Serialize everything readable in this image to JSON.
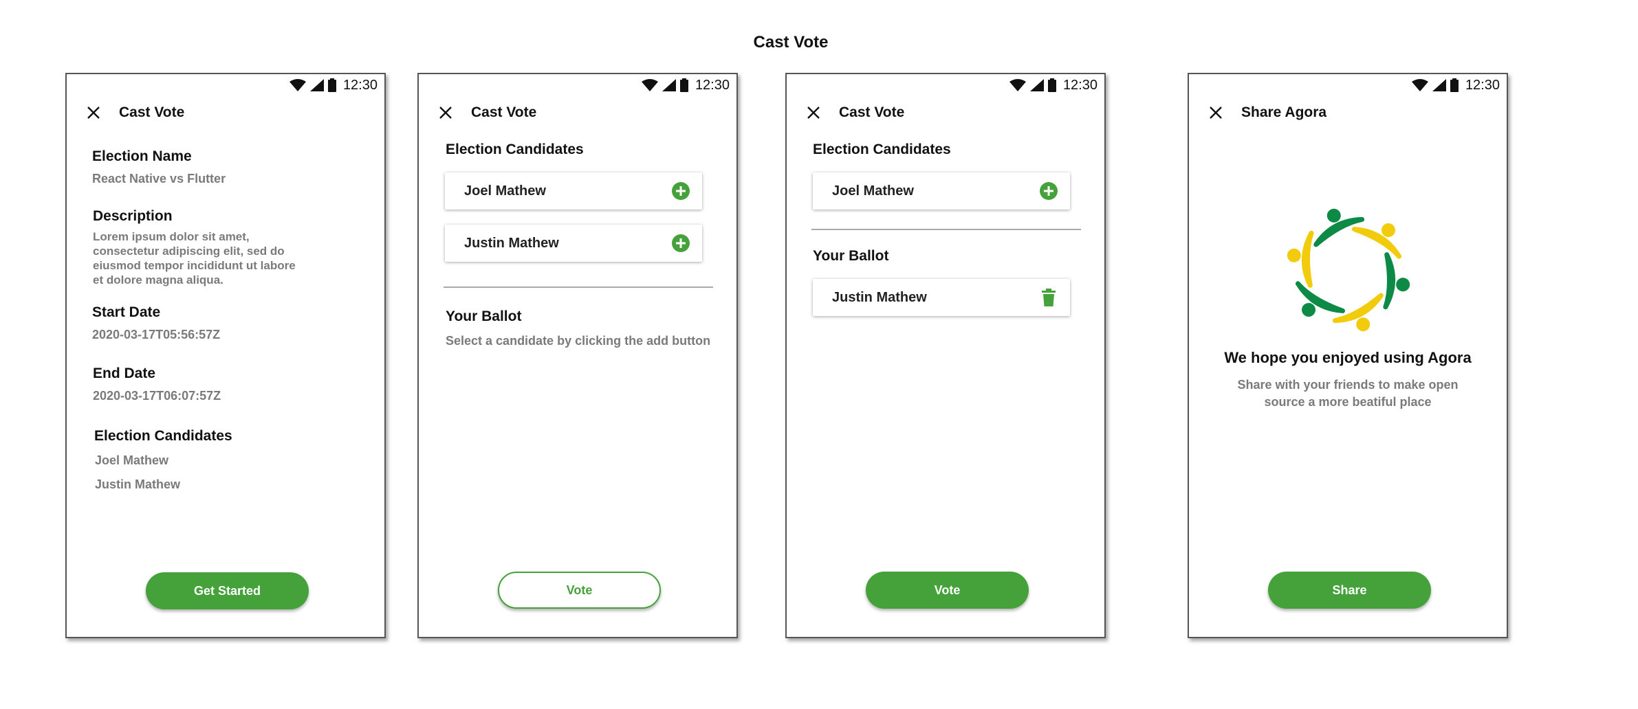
{
  "page": {
    "title": "Cast Vote"
  },
  "status_bar": {
    "time": "12:30"
  },
  "colors": {
    "accent": "#45a23a",
    "logo_green": "#0e8a47",
    "logo_yellow": "#f2cc0c"
  },
  "screen1": {
    "title": "Cast Vote",
    "election_name_label": "Election Name",
    "election_name_value": "React Native vs Flutter",
    "description_label": "Description",
    "description_lines": [
      "Lorem ipsum dolor sit amet,",
      "consectetur adipiscing elit, sed do",
      "eiusmod tempor incididunt ut labore",
      "et dolore magna aliqua."
    ],
    "start_date_label": "Start Date",
    "start_date_value": "2020-03-17T05:56:57Z",
    "end_date_label": "End Date",
    "end_date_value": "2020-03-17T06:07:57Z",
    "candidates_label": "Election Candidates",
    "candidates": [
      "Joel Mathew",
      "Justin Mathew"
    ],
    "button_label": "Get Started"
  },
  "screen2": {
    "title": "Cast Vote",
    "candidates_label": "Election Candidates",
    "candidates": [
      "Joel Mathew",
      "Justin Mathew"
    ],
    "ballot_label": "Your Ballot",
    "ballot_hint": "Select a candidate by clicking the add button",
    "button_label": "Vote"
  },
  "screen3": {
    "title": "Cast Vote",
    "candidates_label": "Election Candidates",
    "candidates": [
      "Joel Mathew"
    ],
    "ballot_label": "Your Ballot",
    "ballot": [
      "Justin Mathew"
    ],
    "button_label": "Vote"
  },
  "screen4": {
    "title": "Share Agora",
    "heading": "We hope you enjoyed using Agora",
    "sub_lines": [
      "Share with your friends to make open",
      "source a more beatiful place"
    ],
    "button_label": "Share"
  },
  "icons": {
    "status": [
      "wifi-icon",
      "signal-icon",
      "battery-icon"
    ],
    "close": "close-icon",
    "add": "add-circle-icon",
    "delete": "trash-icon",
    "logo": "agora-logo"
  }
}
